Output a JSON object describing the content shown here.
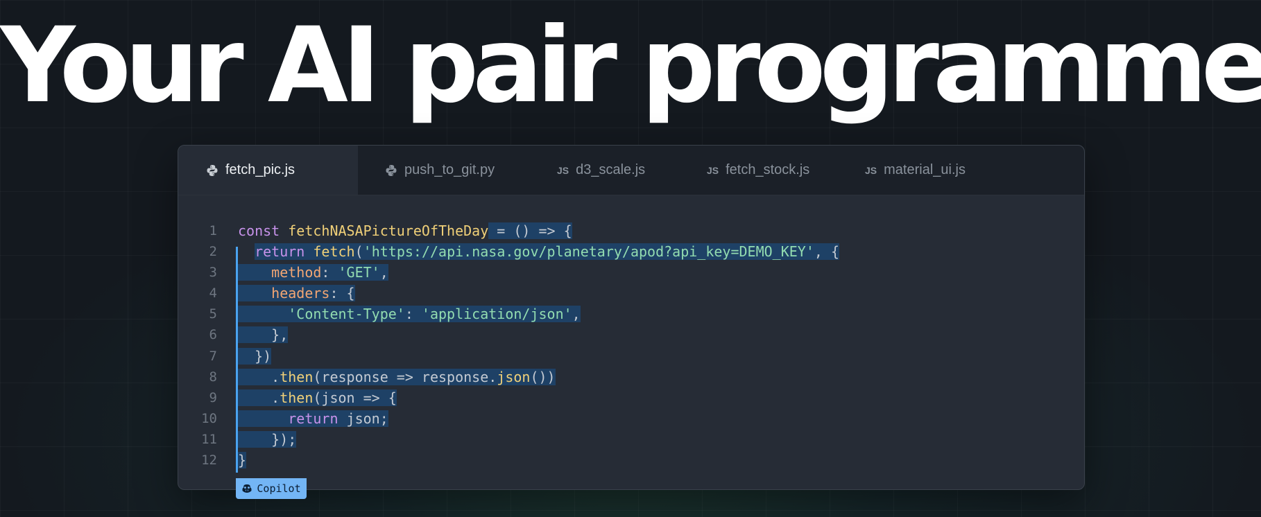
{
  "headline": "Your AI pair programmer",
  "tabs": [
    {
      "label": "fetch_pic.js",
      "icon": "python-icon",
      "icon_text": "",
      "active": true
    },
    {
      "label": "push_to_git.py",
      "icon": "python-icon",
      "icon_text": "",
      "active": false
    },
    {
      "label": "d3_scale.js",
      "icon": "js-icon",
      "icon_text": "JS",
      "active": false
    },
    {
      "label": "fetch_stock.js",
      "icon": "js-icon",
      "icon_text": "JS",
      "active": false
    },
    {
      "label": "material_ui.js",
      "icon": "js-icon",
      "icon_text": "JS",
      "active": false
    }
  ],
  "code": {
    "line_numbers": [
      "1",
      "2",
      "3",
      "4",
      "5",
      "6",
      "7",
      "8",
      "9",
      "10",
      "11",
      "12"
    ],
    "lines": [
      [
        {
          "t": "const ",
          "c": "kw"
        },
        {
          "t": "fetchNASAPictureOfTheDay",
          "c": "fn"
        },
        {
          "t": " = () => {",
          "c": "pl",
          "h": true
        }
      ],
      [
        {
          "t": "  ",
          "c": "pl"
        },
        {
          "t": "return ",
          "c": "kw",
          "h": true
        },
        {
          "t": "fetch",
          "c": "fn",
          "h": true
        },
        {
          "t": "(",
          "c": "pl",
          "h": true
        },
        {
          "t": "'https://api.nasa.gov/planetary/apod?api_key=DEMO_KEY'",
          "c": "str",
          "h": true
        },
        {
          "t": ", {",
          "c": "pl",
          "h": true
        }
      ],
      [
        {
          "t": "  ",
          "c": "pl",
          "h": true
        },
        {
          "t": "  method",
          "c": "prop",
          "h": true
        },
        {
          "t": ": ",
          "c": "pl",
          "h": true
        },
        {
          "t": "'GET'",
          "c": "str",
          "h": true
        },
        {
          "t": ",",
          "c": "pl",
          "h": true
        }
      ],
      [
        {
          "t": "  ",
          "c": "pl",
          "h": true
        },
        {
          "t": "  headers",
          "c": "prop",
          "h": true
        },
        {
          "t": ": {",
          "c": "pl",
          "h": true
        }
      ],
      [
        {
          "t": "      ",
          "c": "pl",
          "h": true
        },
        {
          "t": "'Content-Type'",
          "c": "str",
          "h": true
        },
        {
          "t": ": ",
          "c": "pl",
          "h": true
        },
        {
          "t": "'application/json'",
          "c": "str",
          "h": true
        },
        {
          "t": ",",
          "c": "pl",
          "h": true
        }
      ],
      [
        {
          "t": "    },",
          "c": "pl",
          "h": true
        }
      ],
      [
        {
          "t": "  })",
          "c": "pl",
          "h": true
        }
      ],
      [
        {
          "t": "    .",
          "c": "pl",
          "h": true
        },
        {
          "t": "then",
          "c": "fn",
          "h": true
        },
        {
          "t": "(response => response.",
          "c": "pl",
          "h": true
        },
        {
          "t": "json",
          "c": "fn",
          "h": true
        },
        {
          "t": "())",
          "c": "pl",
          "h": true
        }
      ],
      [
        {
          "t": "    .",
          "c": "pl",
          "h": true
        },
        {
          "t": "then",
          "c": "fn",
          "h": true
        },
        {
          "t": "(json => {",
          "c": "pl",
          "h": true
        }
      ],
      [
        {
          "t": "      ",
          "c": "pl",
          "h": true
        },
        {
          "t": "return ",
          "c": "kw",
          "h": true
        },
        {
          "t": "json;",
          "c": "pl",
          "h": true
        }
      ],
      [
        {
          "t": "    });",
          "c": "pl",
          "h": true
        }
      ],
      [
        {
          "t": "}",
          "c": "pl",
          "h": true
        }
      ]
    ]
  },
  "copilot": {
    "label": "Copilot",
    "icon": "copilot-icon"
  },
  "colors": {
    "keyword": "#c792ea",
    "function": "#f0d078",
    "string": "#93dcb0",
    "property": "#f3a673",
    "highlight": "#1e4166",
    "accent": "#73b5f5"
  }
}
